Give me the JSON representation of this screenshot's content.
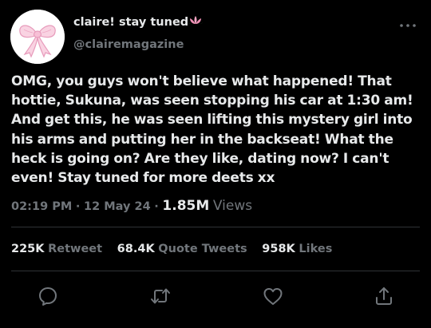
{
  "user": {
    "display_name": "claire! stay tuned",
    "handle": "@clairemagazine",
    "avatar_icon": "pink-bow-icon",
    "name_emoji_icon": "lotus-icon"
  },
  "tweet": {
    "text": "OMG, you guys won't believe what happened! That hottie, Sukuna, was seen stopping his car at 1:30 am! And get this, he was seen lifting this mystery girl into his arms and putting her in the backseat! What the heck is going on? Are they like, dating now? I can't even! Stay tuned for more deets xx",
    "time": "02:19 PM",
    "separator": "·",
    "date": "12 May 24",
    "views_count": "1.85M",
    "views_label": "Views"
  },
  "stats": {
    "retweets": {
      "count": "225K",
      "label": "Retweet"
    },
    "quotes": {
      "count": "68.4K",
      "label": "Quote Tweets"
    },
    "likes": {
      "count": "958K",
      "label": "Likes"
    }
  },
  "actions": [
    "reply-icon",
    "retweet-icon",
    "like-icon",
    "share-icon"
  ],
  "colors": {
    "background": "#000000",
    "text_primary": "#e7e9ea",
    "text_secondary": "#71767b",
    "divider": "#2f3336",
    "bow_pink": "#f7c6d9"
  }
}
